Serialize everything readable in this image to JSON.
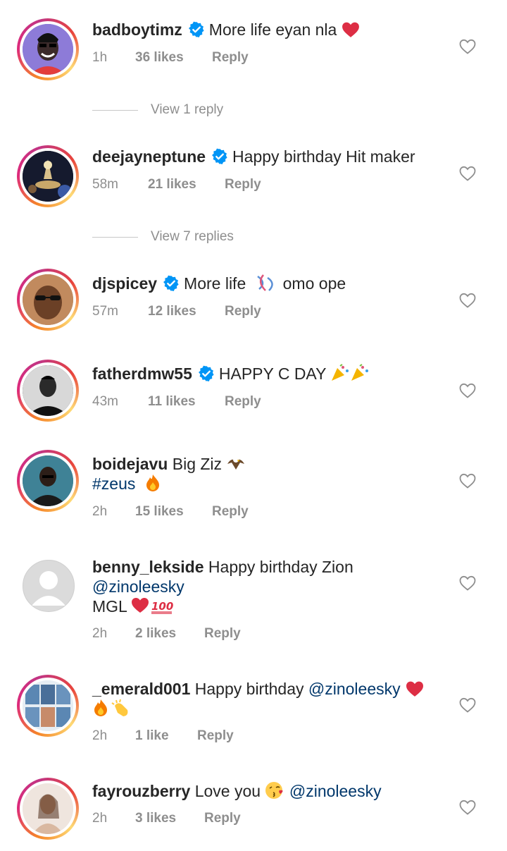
{
  "comments": [
    {
      "username": "badboytimz",
      "verified": true,
      "text": "More life eyan nla",
      "emoji": "heart-emoji",
      "time": "1h",
      "likes": "36 likes",
      "reply": "Reply",
      "view_replies": "View 1 reply"
    },
    {
      "username": "deejayneptune",
      "verified": true,
      "text": "Happy birthday Hit maker",
      "time": "58m",
      "likes": "21 likes",
      "reply": "Reply",
      "view_replies": "View 7 replies"
    },
    {
      "username": "djspicey",
      "verified": true,
      "text": "More life",
      "text2": "omo ope",
      "emoji": "dna-emoji",
      "time": "57m",
      "likes": "12 likes",
      "reply": "Reply"
    },
    {
      "username": "fatherdmw55",
      "verified": true,
      "text": "HAPPY C DAY",
      "emoji": "party-popper-emoji",
      "time": "43m",
      "likes": "11 likes",
      "reply": "Reply"
    },
    {
      "username": "boidejavu",
      "verified": false,
      "text": "Big Ziz",
      "line2": "#zeus",
      "emoji": "eagle-emoji",
      "emoji2": "fire-emoji",
      "time": "2h",
      "likes": "15 likes",
      "reply": "Reply"
    },
    {
      "username": "benny_lekside",
      "verified": false,
      "text": "Happy birthday Zion",
      "line2": "@zinoleesky",
      "line3": "MGL",
      "emoji": "heart-100-emoji",
      "time": "2h",
      "likes": "2 likes",
      "reply": "Reply"
    },
    {
      "username": "_emerald001",
      "verified": false,
      "text": "Happy birthday",
      "mention": "@zinoleesky",
      "emoji": "heart-fire-clap-emoji",
      "time": "2h",
      "likes": "1 like",
      "reply": "Reply"
    },
    {
      "username": "fayrouzberry",
      "verified": false,
      "text": "Love you",
      "mention": "@zinoleesky",
      "emoji": "kiss-emoji",
      "time": "2h",
      "likes": "3 likes",
      "reply": "Reply"
    }
  ],
  "colors": {
    "accent": "#0095f6",
    "mention": "#00376b",
    "meta": "#8e8e8e",
    "text": "#262626"
  }
}
